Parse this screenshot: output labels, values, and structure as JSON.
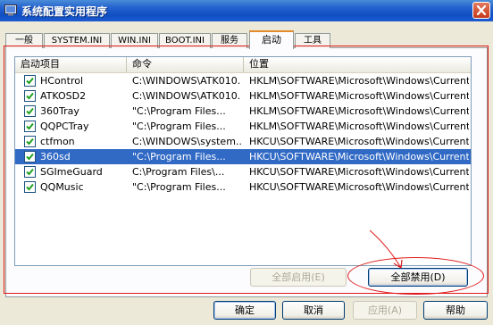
{
  "window": {
    "title": "系统配置实用程序"
  },
  "tabs": [
    {
      "label": "一般"
    },
    {
      "label": "SYSTEM.INI"
    },
    {
      "label": "WIN.INI"
    },
    {
      "label": "BOOT.INI"
    },
    {
      "label": "服务"
    },
    {
      "label": "启动",
      "active": true
    },
    {
      "label": "工具"
    }
  ],
  "list": {
    "columns": [
      "启动项目",
      "命令",
      "位置"
    ],
    "rows": [
      {
        "name": "HControl",
        "command": "C:\\WINDOWS\\ATK010...",
        "location": "HKLM\\SOFTWARE\\Microsoft\\Windows\\Current...",
        "checked": true,
        "selected": false
      },
      {
        "name": "ATKOSD2",
        "command": "C:\\WINDOWS\\ATK010...",
        "location": "HKLM\\SOFTWARE\\Microsoft\\Windows\\Current...",
        "checked": true,
        "selected": false
      },
      {
        "name": "360Tray",
        "command": "\"C:\\Program Files...",
        "location": "HKLM\\SOFTWARE\\Microsoft\\Windows\\Current...",
        "checked": true,
        "selected": false
      },
      {
        "name": "QQPCTray",
        "command": "\"C:\\Program Files...",
        "location": "HKLM\\SOFTWARE\\Microsoft\\Windows\\Current...",
        "checked": true,
        "selected": false
      },
      {
        "name": "ctfmon",
        "command": "C:\\WINDOWS\\system...",
        "location": "HKCU\\SOFTWARE\\Microsoft\\Windows\\Current...",
        "checked": true,
        "selected": false
      },
      {
        "name": "360sd",
        "command": "\"C:\\Program Files...",
        "location": "HKCU\\SOFTWARE\\Microsoft\\Windows\\Current...",
        "checked": true,
        "selected": true
      },
      {
        "name": "SGImeGuard",
        "command": "C:\\Program Files\\...",
        "location": "HKCU\\SOFTWARE\\Microsoft\\Windows\\Current...",
        "checked": true,
        "selected": false
      },
      {
        "name": "QQMusic",
        "command": "\"C:\\Program Files...",
        "location": "HKCU\\SOFTWARE\\Microsoft\\Windows\\Current...",
        "checked": true,
        "selected": false
      }
    ]
  },
  "buttons": {
    "enable_all": "全部启用(E)",
    "disable_all": "全部禁用(D)",
    "ok": "确定",
    "cancel": "取消",
    "apply": "应用(A)",
    "help": "帮助"
  },
  "colors": {
    "title_bar": "#0f4fc2",
    "selection": "#316ac5",
    "annotation": "#e01818",
    "active_tab_accent": "#e68b2c"
  },
  "icons": {
    "app": "msconfig-app-icon",
    "close": "close-icon",
    "check": "checkmark-icon"
  }
}
